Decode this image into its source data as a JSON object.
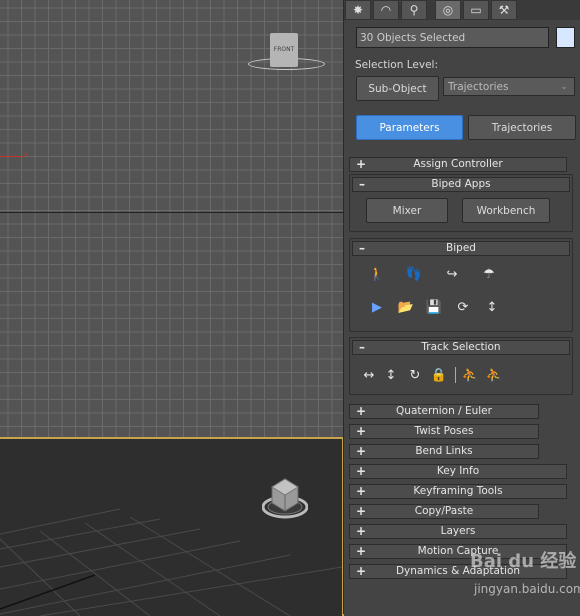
{
  "viewport_top": {
    "cube_label": "FRONT",
    "axis_label": "x"
  },
  "viewport_persp": {
    "cube_label": "TOP"
  },
  "command_tabs": [
    {
      "icon": "create-icon",
      "glyph": "✸"
    },
    {
      "icon": "modify-icon",
      "glyph": "◠"
    },
    {
      "icon": "hierarchy-icon",
      "glyph": "⚲"
    },
    {
      "icon": "motion-icon",
      "glyph": "◎"
    },
    {
      "icon": "display-icon",
      "glyph": "▭"
    },
    {
      "icon": "utilities-icon",
      "glyph": "⚒"
    }
  ],
  "selection_name": "30 Objects Selected",
  "selection_level_label": "Selection Level:",
  "subobject_button": "Sub-Object",
  "subobject_dropdown": "Trajectories",
  "parameters_button": "Parameters",
  "trajectories_button": "Trajectories",
  "rollouts": {
    "assign_controller": {
      "sign": "+",
      "label": "Assign Controller"
    },
    "biped_apps": {
      "sign": "–",
      "label": "Biped Apps"
    },
    "biped": {
      "sign": "–",
      "label": "Biped"
    },
    "track_selection": {
      "sign": "–",
      "label": "Track Selection"
    },
    "quaternion_euler": {
      "sign": "+",
      "label": "Quaternion / Euler"
    },
    "twist_poses": {
      "sign": "+",
      "label": "Twist Poses"
    },
    "bend_links": {
      "sign": "+",
      "label": "Bend Links"
    },
    "key_info": {
      "sign": "+",
      "label": "Key Info"
    },
    "keyframing_tools": {
      "sign": "+",
      "label": "Keyframing Tools"
    },
    "copy_paste": {
      "sign": "+",
      "label": "Copy/Paste"
    },
    "layers": {
      "sign": "+",
      "label": "Layers"
    },
    "motion_capture": {
      "sign": "+",
      "label": "Motion Capture"
    },
    "dynamics_adaptation": {
      "sign": "+",
      "label": "Dynamics & Adaptation"
    }
  },
  "biped_apps_buttons": {
    "mixer": "Mixer",
    "workbench": "Workbench"
  },
  "biped_icons": {
    "figure_mode": "🚶",
    "footstep_mode": "👣",
    "motion_flow": "↪",
    "mixer_mode": "☂",
    "buffer_mode": "▶",
    "load_file": "📂",
    "save_file": "💾",
    "convert": "⟳",
    "move_all": "↕"
  },
  "track_icons": {
    "body_horizontal": "↔",
    "body_vertical": "↕",
    "body_rotation": "↻",
    "lock_com": "🔒",
    "symmetrical": "⛹",
    "opposite": "⛹"
  },
  "watermark": {
    "main": "Bai du 经验",
    "sub": "jingyan.baidu.com"
  }
}
